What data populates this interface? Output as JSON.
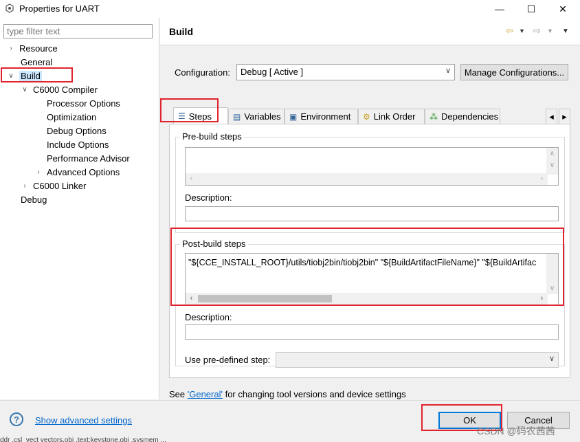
{
  "window": {
    "title": "Properties for UART",
    "min_glyph": "—",
    "max_glyph": "☐",
    "close_glyph": "✕"
  },
  "filter": {
    "placeholder": "type filter text"
  },
  "tree": [
    {
      "label": "Resource"
    },
    {
      "label": "General"
    },
    {
      "label": "Build"
    },
    {
      "label": "C6000 Compiler"
    },
    {
      "label": "Processor Options"
    },
    {
      "label": "Optimization"
    },
    {
      "label": "Debug Options"
    },
    {
      "label": "Include Options"
    },
    {
      "label": "Performance Advisor"
    },
    {
      "label": "Advanced Options"
    },
    {
      "label": "C6000 Linker"
    },
    {
      "label": "Debug"
    }
  ],
  "page": {
    "title": "Build"
  },
  "configuration": {
    "label": "Configuration:",
    "value": "Debug  [ Active ]",
    "manage_button": "Manage Configurations..."
  },
  "tabs": [
    {
      "label": "Steps"
    },
    {
      "label": "Variables"
    },
    {
      "label": "Environment"
    },
    {
      "label": "Link Order"
    },
    {
      "label": "Dependencies"
    }
  ],
  "pre_build": {
    "title": "Pre-build steps",
    "value": "",
    "description_label": "Description:",
    "description_value": ""
  },
  "post_build": {
    "title": "Post-build steps",
    "value": "\"${CCE_INSTALL_ROOT}/utils/tiobj2bin/tiobj2bin\" \"${BuildArtifactFileName}\" \"${BuildArtifac",
    "description_label": "Description:",
    "description_value": ""
  },
  "predefined": {
    "label": "Use pre-defined step:",
    "value": ""
  },
  "footnote": {
    "prefix": "See ",
    "link": "'General'",
    "suffix": " for changing tool versions and device settings"
  },
  "footer": {
    "advanced_link": "Show advanced settings",
    "ok": "OK",
    "cancel": "Cancel"
  },
  "watermark": "CSDN @码农茜茜",
  "background_strip": "ddr   .csl_vect   vectors.obj   .text:keystone.obj    .sysmem ..."
}
